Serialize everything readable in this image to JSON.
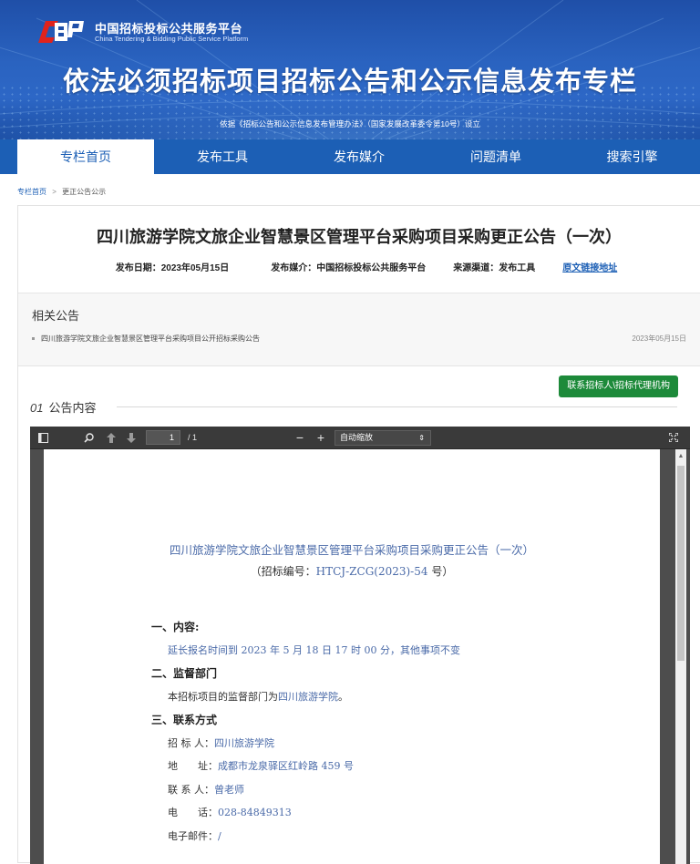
{
  "site": {
    "org_cn": "中国招标投标公共服务平台",
    "org_en": "China Tendering & Bidding Public Service Platform",
    "title": "依法必须招标项目招标公告和公示信息发布专栏",
    "subtitle": "依据《招标公告和公示信息发布管理办法》（国家发展改革委令第10号）设立"
  },
  "nav": {
    "items": [
      "专栏首页",
      "发布工具",
      "发布媒介",
      "问题清单",
      "搜索引擎"
    ]
  },
  "breadcrumb": {
    "home": "专栏首页",
    "sep": ">",
    "current": "更正公告公示"
  },
  "article": {
    "title": "四川旅游学院文旅企业智慧景区管理平台采购项目采购更正公告（一次）",
    "date": "发布日期：2023年05月15日",
    "media": "发布媒介：中国招标投标公共服务平台",
    "source": "来源渠道：发布工具",
    "original_link": "原文链接地址"
  },
  "related": {
    "heading": "相关公告",
    "items": [
      {
        "title": "四川旅游学院文旅企业智慧景区管理平台采购项目公开招标采购公告",
        "date": "2023年05月15日"
      }
    ]
  },
  "content_section": {
    "contact_button": "联系招标人\\招标代理机构",
    "number": "01",
    "label": "公告内容"
  },
  "pdf_viewer": {
    "page_current": "1",
    "page_total": "/ 1",
    "zoom": "自动缩放"
  },
  "pdf_page": {
    "title": "四川旅游学院文旅企业智慧景区管理平台采购项目采购更正公告（一次）",
    "code_prefix": "（招标编号：",
    "code": "HTCJ-ZCG(2023)-54",
    "code_suffix": "号）",
    "s1_heading": "一、内容:",
    "s1_text": "延长报名时间到 2023 年 5 月 18 日 17 时 00 分，其他事项不变",
    "s2_heading": "二、监督部门",
    "s2_prefix": "本招标项目的监督部门为",
    "s2_value": "四川旅游学院",
    "s2_suffix": "。",
    "s3_heading": "三、联系方式",
    "tenderer_label": "招 标 人：",
    "tenderer": "四川旅游学院",
    "address_label": "地　　址：",
    "address": "成都市龙泉驿区红岭路 459 号",
    "contact_label": "联 系 人：",
    "contact": "曾老师",
    "phone_label": "电　　话：",
    "phone": "028-84849313",
    "email_label": "电子邮件：",
    "email": "/"
  }
}
